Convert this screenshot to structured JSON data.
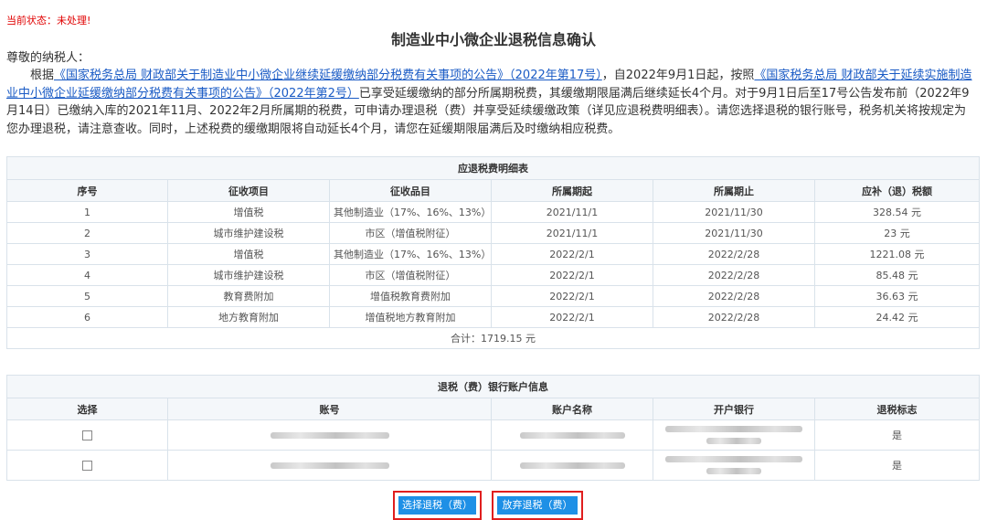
{
  "status": "当前状态：未处理!",
  "title": "制造业中小微企业退税信息确认",
  "greeting": "尊敬的纳税人：",
  "notice": {
    "prefix": "根据",
    "link1": "《国家税务总局 财政部关于制造业中小微企业继续延缓缴纳部分税费有关事项的公告》（2022年第17号）",
    "mid": "，自2022年9月1日起，按照",
    "link2": "《国家税务总局 财政部关于延续实施制造业中小微企业延缓缴纳部分税费有关事项的公告》（2022年第2号）",
    "rest": "已享受延缓缴纳的部分所属期税费，其缓缴期限届满后继续延长4个月。对于9月1日后至17号公告发布前（2022年9月14日）已缴纳入库的2021年11月、2022年2月所属期的税费，可申请办理退税（费）并享受延续缓缴政策（详见应退税费明细表）。请您选择退税的银行账号，税务机关将按规定为您办理退税，请注意查收。同时，上述税费的缓缴期限将自动延长4个月，请您在延缓期限届满后及时缴纳相应税费。"
  },
  "tax_table": {
    "caption": "应退税费明细表",
    "headers": [
      "序号",
      "征收项目",
      "征收品目",
      "所属期起",
      "所属期止",
      "应补（退）税额"
    ],
    "rows": [
      [
        "1",
        "增值税",
        "其他制造业（17%、16%、13%）",
        "2021/11/1",
        "2021/11/30",
        "328.54 元"
      ],
      [
        "2",
        "城市维护建设税",
        "市区（增值税附征）",
        "2021/11/1",
        "2021/11/30",
        "23 元"
      ],
      [
        "3",
        "增值税",
        "其他制造业（17%、16%、13%）",
        "2022/2/1",
        "2022/2/28",
        "1221.08 元"
      ],
      [
        "4",
        "城市维护建设税",
        "市区（增值税附征）",
        "2022/2/1",
        "2022/2/28",
        "85.48 元"
      ],
      [
        "5",
        "教育费附加",
        "增值税教育费附加",
        "2022/2/1",
        "2022/2/28",
        "36.63 元"
      ],
      [
        "6",
        "地方教育附加",
        "增值税地方教育附加",
        "2022/2/1",
        "2022/2/28",
        "24.42 元"
      ]
    ],
    "total": "合计：1719.15 元"
  },
  "bank_table": {
    "caption": "退税（费）银行账户信息",
    "headers": [
      "选择",
      "账号",
      "账户名称",
      "开户银行",
      "退税标志"
    ],
    "rows": [
      {
        "flag": "是"
      },
      {
        "flag": "是"
      }
    ]
  },
  "buttons": {
    "select": "选择退税（费）",
    "abandon": "放弃退税（费）"
  },
  "colors": {
    "status": "#e00000",
    "link": "#1a5bc5",
    "button": "#1e90e6",
    "highlight_box": "#e01e1e",
    "table_border": "#d9e2ea"
  }
}
